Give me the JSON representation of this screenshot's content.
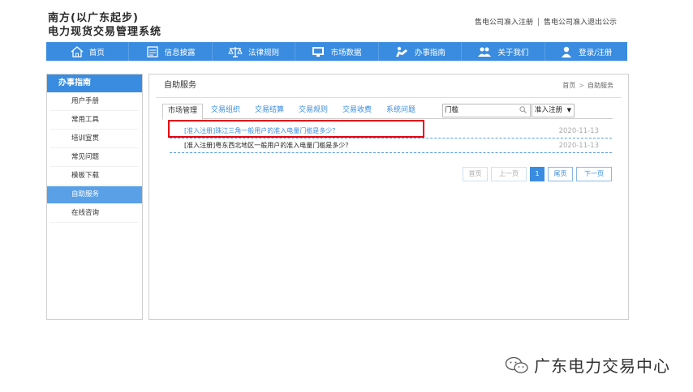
{
  "header": {
    "title_line1": "南方(以广东起步)",
    "title_line2": "电力现货交易管理系统",
    "link1": "售电公司准入注册",
    "link2": "售电公司准入退出公示"
  },
  "nav": [
    {
      "label": "首页",
      "icon": "home-icon"
    },
    {
      "label": "信息披露",
      "icon": "document-icon"
    },
    {
      "label": "法律规则",
      "icon": "scale-icon"
    },
    {
      "label": "市场数据",
      "icon": "monitor-icon"
    },
    {
      "label": "办事指南",
      "icon": "guide-icon"
    },
    {
      "label": "关于我们",
      "icon": "people-icon"
    },
    {
      "label": "登录/注册",
      "icon": "user-icon"
    }
  ],
  "sidebar": {
    "heading": "办事指南",
    "items": [
      {
        "label": "用户手册"
      },
      {
        "label": "常用工具"
      },
      {
        "label": "培训宣贯"
      },
      {
        "label": "常见问题"
      },
      {
        "label": "模板下载"
      },
      {
        "label": "自助服务"
      },
      {
        "label": "在线咨询"
      }
    ]
  },
  "main": {
    "title": "自助服务",
    "breadcrumb_home": "首页",
    "breadcrumb_sep": ">",
    "breadcrumb_current": "自助服务",
    "tabs": [
      "市场管理",
      "交易组织",
      "交易结算",
      "交易规则",
      "交易收费",
      "系统问题"
    ],
    "search_value": "门槛",
    "select_value": "准入注册",
    "rows": [
      {
        "text": "[准入注册]珠江三角一般用户的准入电量门槛是多少？",
        "date": "2020-11-13"
      },
      {
        "text": "[准入注册]粤东西北地区一般用户的准入电量门槛是多少？",
        "date": "2020-11-13"
      }
    ],
    "pager": {
      "first": "首页",
      "prev": "上一页",
      "current": "1",
      "last": "尾页",
      "next": "下一页"
    }
  },
  "watermark": "广东电力交易中心",
  "colors": {
    "accent": "#3a8ce0",
    "highlight": "#e60012"
  }
}
